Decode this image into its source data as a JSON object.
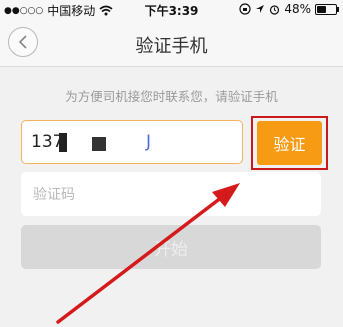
{
  "status_bar": {
    "carrier": "中国移动",
    "time": "下午3:39",
    "battery": "48%",
    "battery_level": 0.48,
    "icons": [
      "signal-dots-icon",
      "wifi-icon",
      "lock-rotation-icon",
      "location-arrow-icon",
      "alarm-icon",
      "battery-icon"
    ]
  },
  "nav": {
    "title": "验证手机",
    "back_icon": "chevron-left-icon"
  },
  "form": {
    "hint": "为方便司机接您时联系您，请验证手机",
    "phone_value_prefix": "137",
    "phone_value_suffix": "J",
    "verify_label": "验证",
    "code_placeholder": "验证码",
    "start_label": "开始"
  },
  "colors": {
    "accent": "#f79a14",
    "annotation_red": "#c8191b",
    "input_focus_border": "#f2b35c",
    "disabled_button": "#d8d8d8"
  }
}
